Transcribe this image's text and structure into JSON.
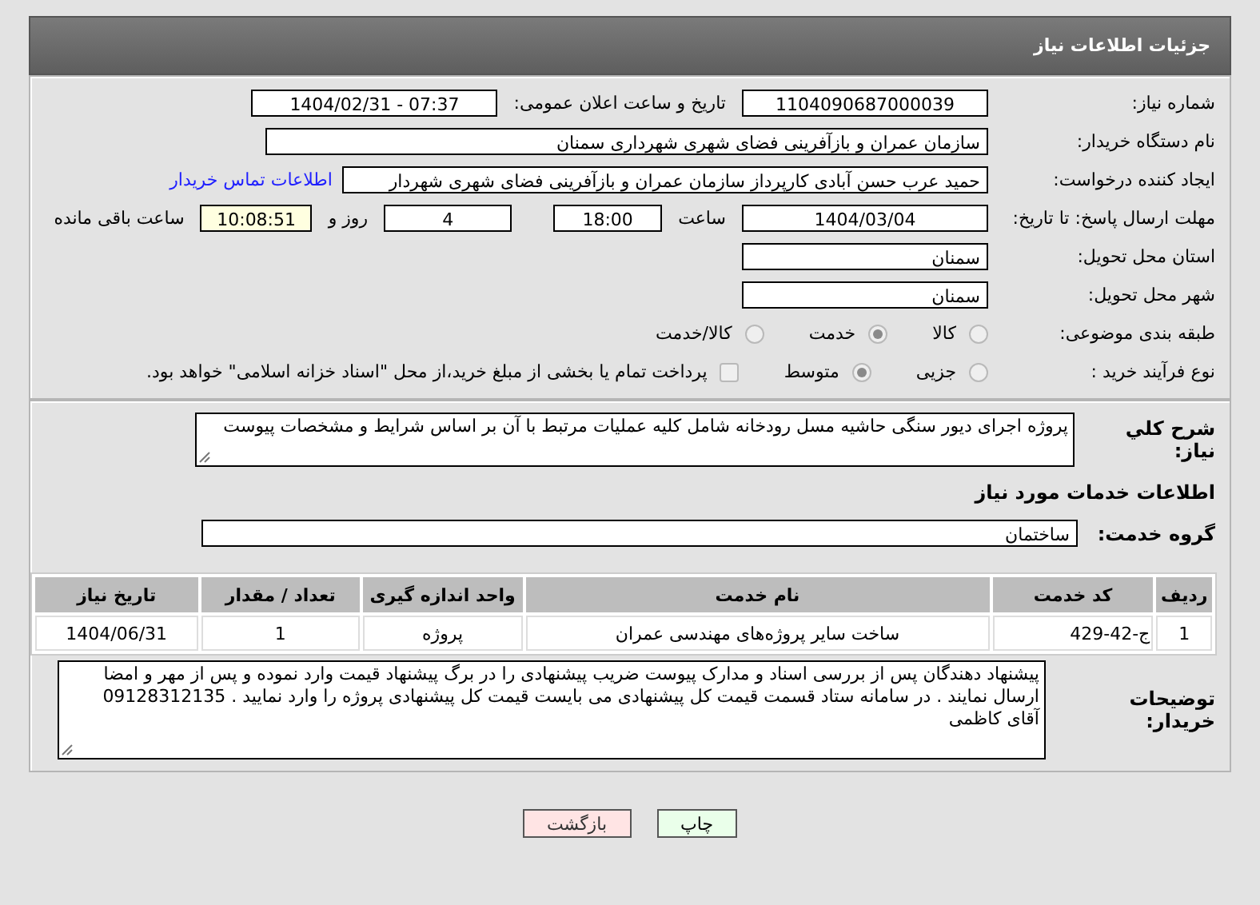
{
  "header": {
    "title": "جزئیات اطلاعات نیاز"
  },
  "details": [
    {
      "label": "شماره نیاز:",
      "items": [
        {
          "kind": "field",
          "value": "1104090687000039"
        },
        {
          "kind": "text",
          "value": "تاریخ و ساعت اعلان عمومی:"
        },
        {
          "kind": "field",
          "value": "1404/02/31 - 07:37"
        }
      ]
    },
    {
      "label": "نام دستگاه خریدار:",
      "items": [
        {
          "kind": "long",
          "value": "سازمان عمران و بازآفرینی فضای شهری شهرداری سمنان"
        }
      ]
    },
    {
      "label": "ایجاد کننده درخواست:",
      "items": [
        {
          "kind": "medium",
          "value": "حمید عرب حسن آبادی کارپرداز سازمان عمران و بازآفرینی فضای شهری شهردار"
        },
        {
          "kind": "link",
          "value": "اطلاعات تماس خریدار"
        }
      ]
    },
    {
      "label": "مهلت ارسال پاسخ: تا تاریخ:",
      "items": [
        {
          "kind": "field",
          "value": "1404/03/04"
        },
        {
          "kind": "text",
          "value": "ساعت"
        },
        {
          "kind": "small",
          "value": "18:00"
        },
        {
          "kind": "small",
          "value": "4"
        },
        {
          "kind": "text",
          "value": "روز و"
        },
        {
          "kind": "timer",
          "value": "10:08:51"
        },
        {
          "kind": "text",
          "value": "ساعت باقی مانده"
        }
      ]
    },
    {
      "label": "استان محل تحویل:",
      "items": [
        {
          "kind": "place",
          "value": "سمنان"
        }
      ]
    },
    {
      "label": "شهر محل تحویل:",
      "items": [
        {
          "kind": "place",
          "value": "سمنان"
        }
      ]
    },
    {
      "label": "طبقه بندی موضوعی:",
      "items": [
        {
          "kind": "radio",
          "value": "کالا",
          "selected": false
        },
        {
          "kind": "radio",
          "value": "خدمت",
          "selected": true
        },
        {
          "kind": "radio",
          "value": "کالا/خدمت",
          "selected": false
        }
      ]
    },
    {
      "label": "نوع فرآیند خرید :",
      "items": [
        {
          "kind": "radio",
          "value": "جزیی",
          "selected": false
        },
        {
          "kind": "radio",
          "value": "متوسط",
          "selected": true
        },
        {
          "kind": "checkbox",
          "value": "پرداخت تمام یا بخشی از مبلغ خرید،از محل \"اسناد خزانه اسلامی\" خواهد بود.",
          "checked": false
        }
      ]
    }
  ],
  "description": {
    "label": "شرح کلي نياز:",
    "value": "پروژه اجرای دیور سنگی حاشیه مسل رودخانه شامل کلیه عملیات مرتبط با آن بر اساس شرایط و مشخصات پیوست"
  },
  "services": {
    "title": "اطلاعات خدمات مورد نیاز",
    "group_label": "گروه خدمت:",
    "group_value": "ساختمان",
    "columns": [
      "ردیف",
      "کد خدمت",
      "نام خدمت",
      "واحد اندازه گیری",
      "تعداد / مقدار",
      "تاریخ نیاز"
    ],
    "rows": [
      [
        "1",
        "ج-42-429",
        "ساخت سایر پروژه‌های مهندسی عمران",
        "پروژه",
        "1",
        "1404/06/31"
      ]
    ]
  },
  "notes": {
    "label": "توضیحات خریدار:",
    "value": "پیشنهاد دهندگان پس از بررسی اسناد و مدارک پیوست ضریب پیشنهادی را در برگ پیشنهاد قیمت وارد نموده و پس از مهر و امضا ارسال نمایند . در سامانه ستاد قسمت قیمت کل پیشنهادی می بایست قیمت کل پیشنهادی پروژه را وارد نمایید . 09128312135 آقای کاظمی"
  },
  "buttons": [
    {
      "kind": "print",
      "label": "چاپ"
    },
    {
      "kind": "back",
      "label": "بازگشت"
    }
  ]
}
